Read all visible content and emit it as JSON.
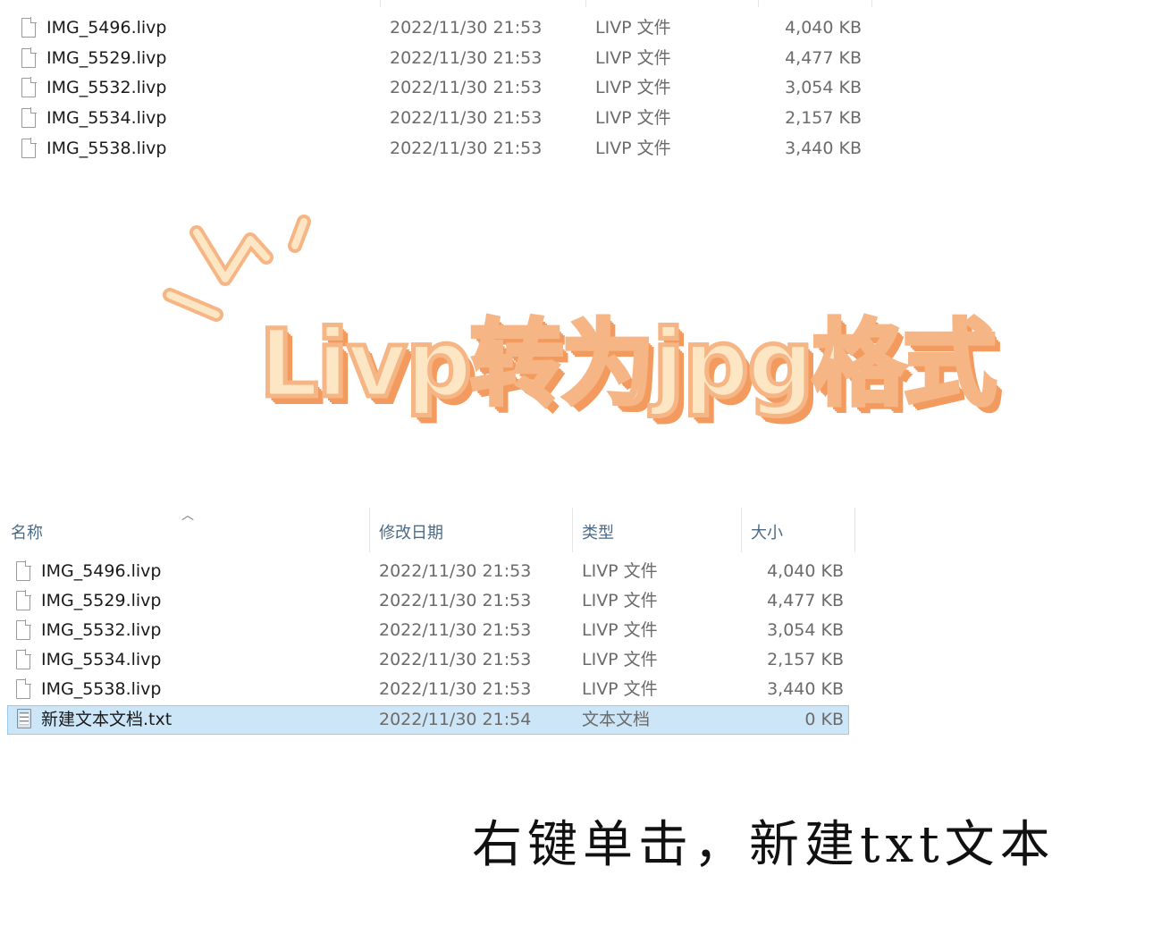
{
  "top_list": {
    "files": [
      {
        "name": "IMG_5496.livp",
        "date": "2022/11/30 21:53",
        "type": "LIVP 文件",
        "size": "4,040 KB"
      },
      {
        "name": "IMG_5529.livp",
        "date": "2022/11/30 21:53",
        "type": "LIVP 文件",
        "size": "4,477 KB"
      },
      {
        "name": "IMG_5532.livp",
        "date": "2022/11/30 21:53",
        "type": "LIVP 文件",
        "size": "3,054 KB"
      },
      {
        "name": "IMG_5534.livp",
        "date": "2022/11/30 21:53",
        "type": "LIVP 文件",
        "size": "2,157 KB"
      },
      {
        "name": "IMG_5538.livp",
        "date": "2022/11/30 21:53",
        "type": "LIVP 文件",
        "size": "3,440 KB"
      }
    ]
  },
  "title": "Livp转为jpg格式",
  "explorer": {
    "columns": {
      "name": "名称",
      "date": "修改日期",
      "type": "类型",
      "size": "大小"
    },
    "files": [
      {
        "name": "IMG_5496.livp",
        "date": "2022/11/30 21:53",
        "type": "LIVP 文件",
        "size": "4,040 KB",
        "icon": "file-icon"
      },
      {
        "name": "IMG_5529.livp",
        "date": "2022/11/30 21:53",
        "type": "LIVP 文件",
        "size": "4,477 KB",
        "icon": "file-icon"
      },
      {
        "name": "IMG_5532.livp",
        "date": "2022/11/30 21:53",
        "type": "LIVP 文件",
        "size": "3,054 KB",
        "icon": "file-icon"
      },
      {
        "name": "IMG_5534.livp",
        "date": "2022/11/30 21:53",
        "type": "LIVP 文件",
        "size": "2,157 KB",
        "icon": "file-icon"
      },
      {
        "name": "IMG_5538.livp",
        "date": "2022/11/30 21:53",
        "type": "LIVP 文件",
        "size": "3,440 KB",
        "icon": "file-icon"
      },
      {
        "name": "新建文本文档.txt",
        "date": "2022/11/30 21:54",
        "type": "文本文档",
        "size": "0 KB",
        "icon": "text-file-icon",
        "selected": true
      }
    ],
    "selection_color": "#cce6f8"
  },
  "caption": "右键单击，新建txt文本",
  "colors": {
    "title_fill": "#fde6c3",
    "title_stroke": "#f39a5e",
    "header_text": "#4d6a86"
  }
}
